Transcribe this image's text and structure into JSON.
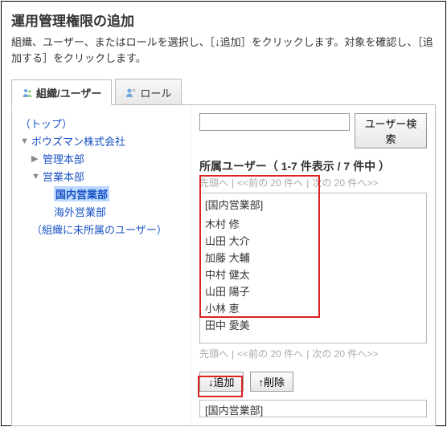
{
  "title": "運用管理権限の追加",
  "description": "組織、ユーザー、またはロールを選択し、［↓追加］をクリックします。対象を確認し、［追加する］をクリックします。",
  "tabs": {
    "org_user": "組織/ユーザー",
    "role": "ロール"
  },
  "tree": {
    "top": "（トップ）",
    "company": "ボウズマン株式会社",
    "admin": "管理本部",
    "sales": "営業本部",
    "domestic": "国内営業部",
    "overseas": "海外営業部",
    "unassigned": "（組織に未所属のユーザー）"
  },
  "search_placeholder": "",
  "search_button": "ユーザー検索",
  "list": {
    "heading": "所属ユーザー（ 1-7 件表示 / 7 件中 ）",
    "pager_first": "先頭へ",
    "pager_prev": "<<前の 20 件へ",
    "pager_next": "次の 20 件へ>>",
    "group_label": "[国内営業部]",
    "items": [
      "木村 修",
      "山田 大介",
      "加藤 大輔",
      "中村 健太",
      "山田 陽子",
      "小林 恵",
      "田中 愛美"
    ]
  },
  "buttons": {
    "add": "↓追加",
    "remove": "↑削除"
  },
  "result_group": "[国内営業部]"
}
